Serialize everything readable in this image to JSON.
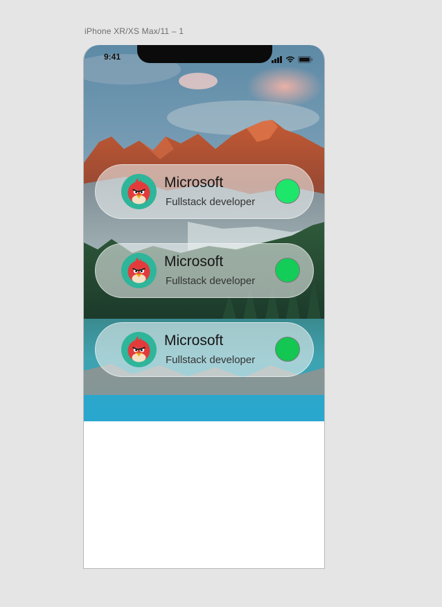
{
  "artboard": {
    "label": "iPhone XR/XS Max/11 – 1"
  },
  "status_bar": {
    "time": "9:41",
    "icons": [
      "cellular-signal-icon",
      "wifi-icon",
      "battery-icon"
    ]
  },
  "background": {
    "image": "mountain-lake-landscape"
  },
  "cards": [
    {
      "title": "Microsoft",
      "subtitle": "Fullstack developer",
      "avatar": "angry-bird-avatar",
      "status_color": "#1de66a"
    },
    {
      "title": "Microsoft",
      "subtitle": "Fullstack developer",
      "avatar": "angry-bird-avatar",
      "status_color": "#14cc58"
    },
    {
      "title": "Microsoft",
      "subtitle": "Fullstack developer",
      "avatar": "angry-bird-avatar",
      "status_color": "#14c652"
    }
  ],
  "colors": {
    "canvas_background": "#e5e5e5",
    "avatar_ring": "#2fb59a",
    "bird_red": "#e33b3b"
  }
}
